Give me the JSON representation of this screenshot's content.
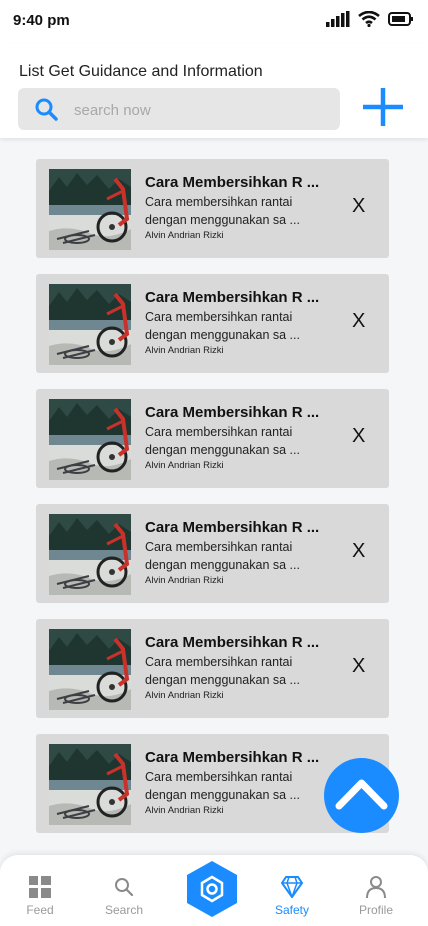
{
  "status": {
    "time": "9:40 pm"
  },
  "header": {
    "title": "List Get Guidance and Information"
  },
  "search": {
    "placeholder": "search now"
  },
  "cards": [
    {
      "title": "Cara Membersihkan R ...",
      "desc1": "Cara membersihkan rantai",
      "desc2": "dengan menggunakan sa ...",
      "author": "Alvin Andrian Rizki",
      "delete": "X"
    },
    {
      "title": "Cara Membersihkan R ...",
      "desc1": "Cara membersihkan rantai",
      "desc2": "dengan menggunakan sa ...",
      "author": "Alvin Andrian Rizki",
      "delete": "X"
    },
    {
      "title": "Cara Membersihkan R ...",
      "desc1": "Cara membersihkan rantai",
      "desc2": "dengan menggunakan sa ...",
      "author": "Alvin Andrian Rizki",
      "delete": "X"
    },
    {
      "title": "Cara Membersihkan R ...",
      "desc1": "Cara membersihkan rantai",
      "desc2": "dengan menggunakan sa ...",
      "author": "Alvin Andrian Rizki",
      "delete": "X"
    },
    {
      "title": "Cara Membersihkan R ...",
      "desc1": "Cara membersihkan rantai",
      "desc2": "dengan menggunakan sa ...",
      "author": "Alvin Andrian Rizki",
      "delete": "X"
    },
    {
      "title": "Cara Membersihkan R ...",
      "desc1": "Cara membersihkan rantai",
      "desc2": "dengan menggunakan sa ...",
      "author": "Alvin Andrian Rizki",
      "delete": ""
    }
  ],
  "tabs": [
    {
      "label": "Feed",
      "icon": "grid-icon"
    },
    {
      "label": "Search",
      "icon": "search-icon"
    },
    {
      "label": "",
      "icon": "hexagon-icon"
    },
    {
      "label": "Safety",
      "icon": "diamond-icon"
    },
    {
      "label": "Profile",
      "icon": "person-icon"
    }
  ],
  "colors": {
    "accent": "#1a8cff",
    "card": "#d9d9d9",
    "background": "#f4f6f8"
  }
}
